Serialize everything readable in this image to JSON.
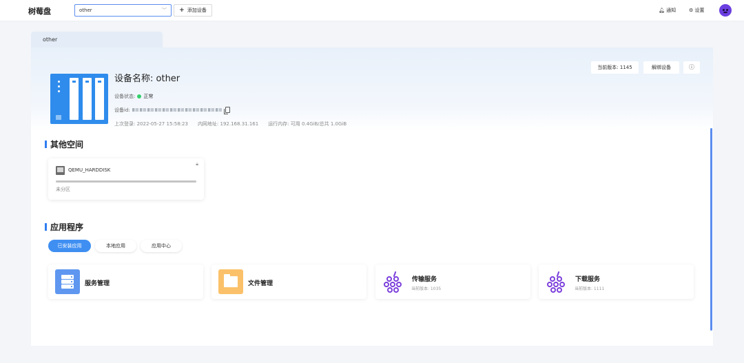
{
  "topbar": {
    "brand": "树莓盘",
    "device_select": "other",
    "add_device": "添加设备",
    "notify": "通知",
    "settings": "设置"
  },
  "tab": {
    "label": "other"
  },
  "device": {
    "current_version": "当前版本: 1145",
    "unbind": "解绑设备",
    "info_icon": "ⓘ",
    "title": "设备名称: other",
    "status_label": "设备状态:",
    "status_value": "正常",
    "id_label": "设备id:",
    "last_login": "上次登录: 2022-05-27 15:58:23",
    "lan_ip": "内网地址: 192.168.31.161",
    "memory": "运行内存: 可用 0.4GiB/总共 1.0GiB"
  },
  "other_space": {
    "title": "其他空间",
    "disk": {
      "name": "QEMU_HARDDISK",
      "sub": "未分区"
    }
  },
  "apps": {
    "title": "应用程序",
    "tabs": [
      "已安装应用",
      "本地应用",
      "应用中心"
    ],
    "items": [
      {
        "name": "服务管理",
        "version": ""
      },
      {
        "name": "文件管理",
        "version": ""
      },
      {
        "name": "传输服务",
        "version": "当前版本: 1035"
      },
      {
        "name": "下载服务",
        "version": "当前版本: 1111"
      }
    ]
  },
  "colors": {
    "accent": "#2f7cf0",
    "status_ok": "#31d06b",
    "device_icon": "#2f8cec",
    "avatar": "#6b3fe0",
    "grape": "#7b3fdc",
    "folder": "#fbc16a"
  }
}
